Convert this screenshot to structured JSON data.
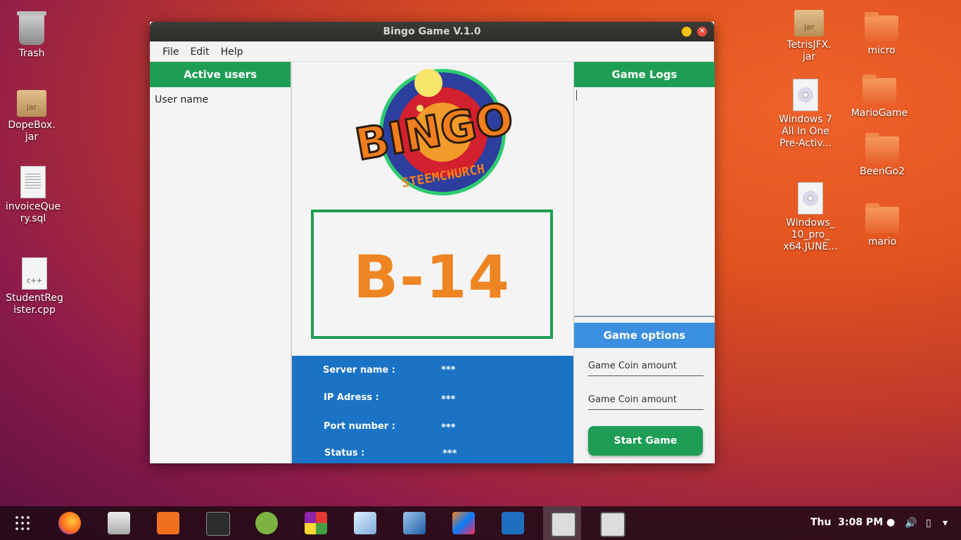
{
  "desktop": {
    "icons": [
      {
        "label": "Trash"
      },
      {
        "label": "DopeBox.\njar",
        "icon_text": "jar"
      },
      {
        "label": "invoiceQue\nry.sql"
      },
      {
        "label": "StudentReg\nister.cpp",
        "icon_text": "c++"
      },
      {
        "label": "TetrisJFX.\njar",
        "icon_text": "jar"
      },
      {
        "label": "micro"
      },
      {
        "label": "Windows 7\nAll In One\nPre-Activ..."
      },
      {
        "label": "MarioGame"
      },
      {
        "label": "BeenGo2"
      },
      {
        "label": "Windows_\n10_pro_\nx64.JUNE..."
      },
      {
        "label": "mario"
      }
    ]
  },
  "window": {
    "title": "Bingo Game V.1.0",
    "menu": [
      "File",
      "Edit",
      "Help"
    ]
  },
  "left_panel": {
    "header": "Active users",
    "user_label": "User name"
  },
  "center": {
    "logo_main": "BINGO",
    "logo_sub": "STEEMCHURCH",
    "current_number": "B-14",
    "server_info": [
      {
        "label": "Server name :",
        "value": "***"
      },
      {
        "label": "IP Adress :",
        "value": "***"
      },
      {
        "label": "Port number :",
        "value": "***"
      },
      {
        "label": "Status :",
        "value": "***"
      }
    ]
  },
  "right_panel": {
    "logs_header": "Game Logs",
    "options_header": "Game options",
    "field1_placeholder": "Game Coin amount",
    "field2_placeholder": "Game Coin amount",
    "start_label": "Start Game"
  },
  "taskbar": {
    "apps": [
      "firefox",
      "files",
      "software-center",
      "terminal",
      "android-studio",
      "grid-app",
      "virtual-box-cube",
      "virtualbox",
      "intellij",
      "vscode",
      "java-app-1",
      "java-app-2"
    ],
    "day": "Thu",
    "time": "3:08 PM"
  },
  "colors": {
    "green": "#1e9e55",
    "blue": "#1a73c4",
    "orange_number": "#ee8522"
  }
}
